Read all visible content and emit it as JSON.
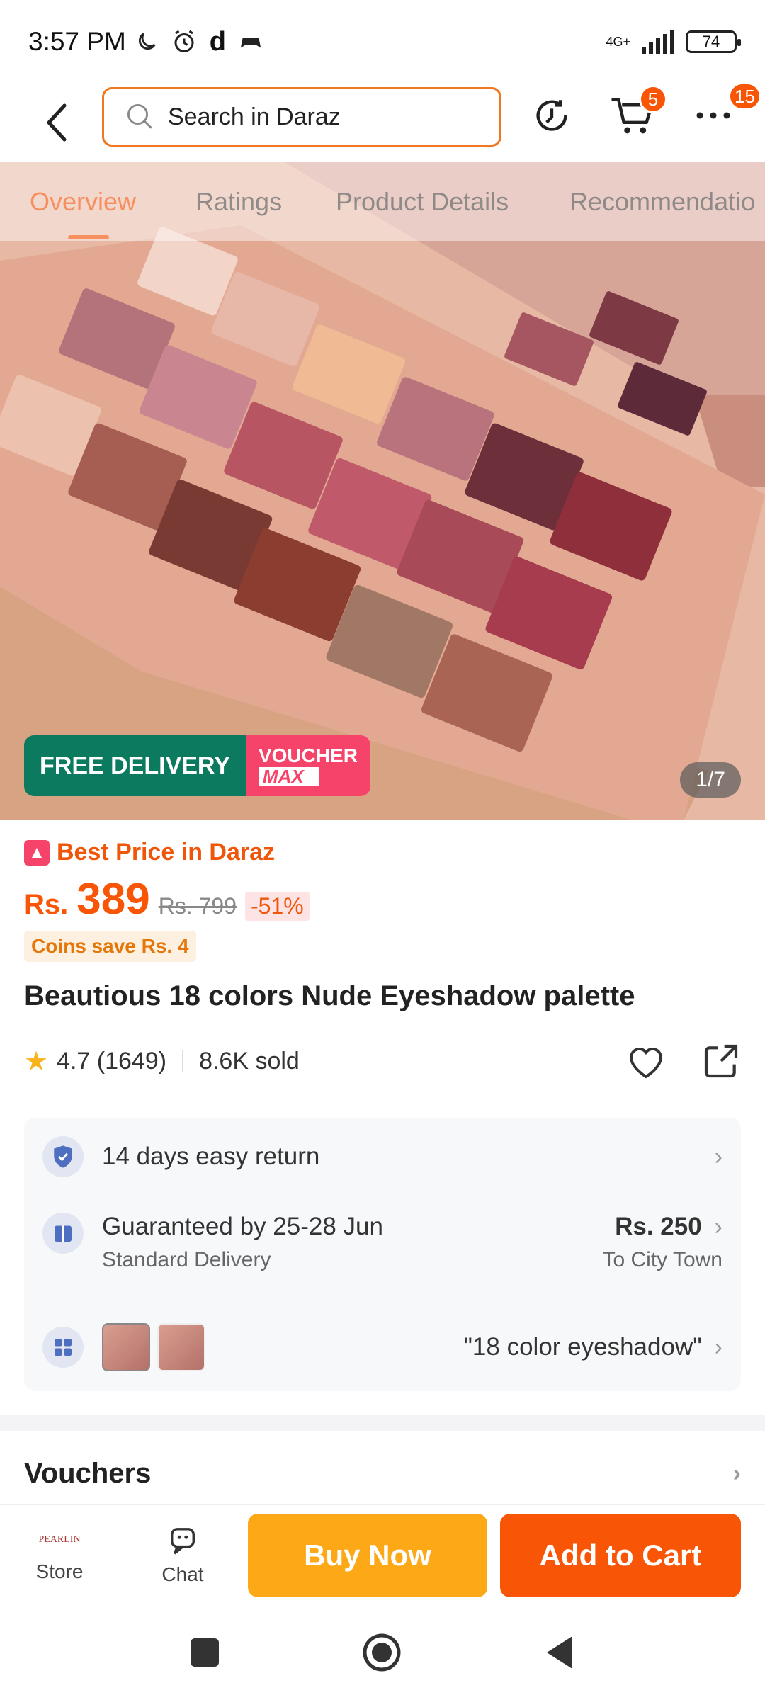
{
  "status_bar": {
    "time": "3:57 PM",
    "network": "4G+",
    "battery": "74"
  },
  "header": {
    "search_placeholder": "Search in Daraz",
    "cart_count": "5",
    "more_count": "15"
  },
  "tabs": [
    {
      "label": "Overview"
    },
    {
      "label": "Ratings"
    },
    {
      "label": "Product Details"
    },
    {
      "label": "Recommendatio"
    }
  ],
  "hero": {
    "free_delivery": "FREE DELIVERY",
    "voucher": "VOUCHER",
    "voucher_max": "MAX",
    "image_counter": "1/7"
  },
  "product": {
    "best_price": "Best Price in Daraz",
    "currency": "Rs.",
    "price": "389",
    "old_price": "Rs. 799",
    "discount": "-51%",
    "coins": "Coins save Rs. 4",
    "title": "Beautious 18 colors Nude Eyeshadow palette",
    "rating": "4.7 (1649)",
    "sold": "8.6K sold"
  },
  "services": {
    "return": "14 days easy return",
    "delivery_title": "Guaranteed by 25-28 Jun",
    "delivery_sub": "Standard Delivery",
    "delivery_price": "Rs. 250",
    "delivery_location": "To City Town",
    "variant": "\"18 color eyeshadow\""
  },
  "vouchers_title": "Vouchers",
  "action_bar": {
    "store_logo": "PEARLIN",
    "store": "Store",
    "chat": "Chat",
    "buy_now": "Buy Now",
    "add_to_cart": "Add to Cart"
  },
  "colors": {
    "brand": "#f85606",
    "buy_now": "#fca817",
    "free_delivery": "#0b7a5e",
    "voucher": "#f5436a"
  }
}
